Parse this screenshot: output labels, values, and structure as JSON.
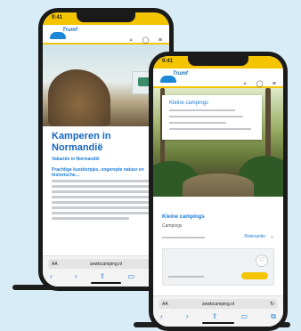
{
  "colors": {
    "background": "#d8ecf7",
    "accent": "#f5c400",
    "brand": "#1e6fb8",
    "link": "#1e7bd8"
  },
  "back_phone": {
    "time": "9:41",
    "logo": "Trumf",
    "nav_icons": [
      "search-icon",
      "user-icon",
      "menu-icon"
    ],
    "page_title": "Kamperen in Normandië",
    "page_subtitle": "Vakantie in Normandië",
    "page_lead": "Prachtige kustdorpjes, ongerepte natuur en historische…",
    "url": "anwbcamping.nl",
    "url_prefix": "AA"
  },
  "front_phone": {
    "time": "9:41",
    "logo": "Trumf",
    "nav_icons": [
      "search-icon",
      "user-icon",
      "menu-icon"
    ],
    "menu_card_title": "Kleine campings",
    "section_title": "Kleine campings",
    "section_subtitle": "Campings",
    "sort_label": "Relevantie",
    "url": "anwbcamping.nl",
    "url_prefix": "AA"
  },
  "toolbar_icons": [
    "back-icon",
    "forward-icon",
    "share-icon",
    "bookmarks-icon",
    "tabs-icon"
  ]
}
